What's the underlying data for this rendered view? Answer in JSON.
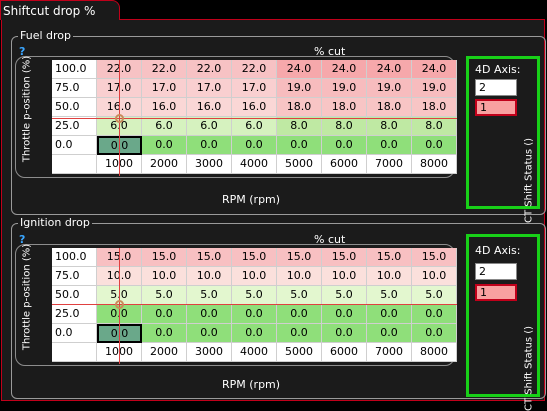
{
  "tab": {
    "title": "Shiftcut drop %"
  },
  "help_glyph": "?",
  "fuel": {
    "title": "Fuel drop",
    "col_title": "% cut",
    "y_label": "Throttle p-osition (%)",
    "x_label": "RPM (rpm)",
    "rows": [
      {
        "label": "100.0",
        "values": [
          "22.0",
          "22.0",
          "22.0",
          "22.0",
          "24.0",
          "24.0",
          "24.0",
          "24.0"
        ]
      },
      {
        "label": "75.0",
        "values": [
          "17.0",
          "17.0",
          "17.0",
          "17.0",
          "19.0",
          "19.0",
          "19.0",
          "19.0"
        ]
      },
      {
        "label": "50.0",
        "values": [
          "16.0",
          "16.0",
          "16.0",
          "16.0",
          "18.0",
          "18.0",
          "18.0",
          "18.0"
        ]
      },
      {
        "label": "25.0",
        "values": [
          "6.0",
          "6.0",
          "6.0",
          "6.0",
          "8.0",
          "8.0",
          "8.0",
          "8.0"
        ]
      },
      {
        "label": "0.0",
        "values": [
          "0.0",
          "0.0",
          "0.0",
          "0.0",
          "0.0",
          "0.0",
          "0.0",
          "0.0"
        ]
      }
    ],
    "rpm": [
      "1000",
      "2000",
      "3000",
      "4000",
      "5000",
      "6000",
      "7000",
      "8000"
    ],
    "axis": {
      "title": "4D Axis:",
      "value1": "2",
      "value2": "1",
      "label": "CT Shift Status ()"
    }
  },
  "ignition": {
    "title": "Ignition drop",
    "col_title": "% cut",
    "y_label": "Throttle p-osition (%)",
    "x_label": "RPM (rpm)",
    "rows": [
      {
        "label": "100.0",
        "values": [
          "15.0",
          "15.0",
          "15.0",
          "15.0",
          "15.0",
          "15.0",
          "15.0",
          "15.0"
        ]
      },
      {
        "label": "75.0",
        "values": [
          "10.0",
          "10.0",
          "10.0",
          "10.0",
          "10.0",
          "10.0",
          "10.0",
          "10.0"
        ]
      },
      {
        "label": "50.0",
        "values": [
          "5.0",
          "5.0",
          "5.0",
          "5.0",
          "5.0",
          "5.0",
          "5.0",
          "5.0"
        ]
      },
      {
        "label": "25.0",
        "values": [
          "0.0",
          "0.0",
          "0.0",
          "0.0",
          "0.0",
          "0.0",
          "0.0",
          "0.0"
        ]
      },
      {
        "label": "0.0",
        "values": [
          "0.0",
          "0.0",
          "0.0",
          "0.0",
          "0.0",
          "0.0",
          "0.0",
          "0.0"
        ]
      }
    ],
    "rpm": [
      "1000",
      "2000",
      "3000",
      "4000",
      "5000",
      "6000",
      "7000",
      "8000"
    ],
    "axis": {
      "title": "4D Axis:",
      "value1": "2",
      "value2": "1",
      "label": "CT Shift Status ()"
    }
  }
}
